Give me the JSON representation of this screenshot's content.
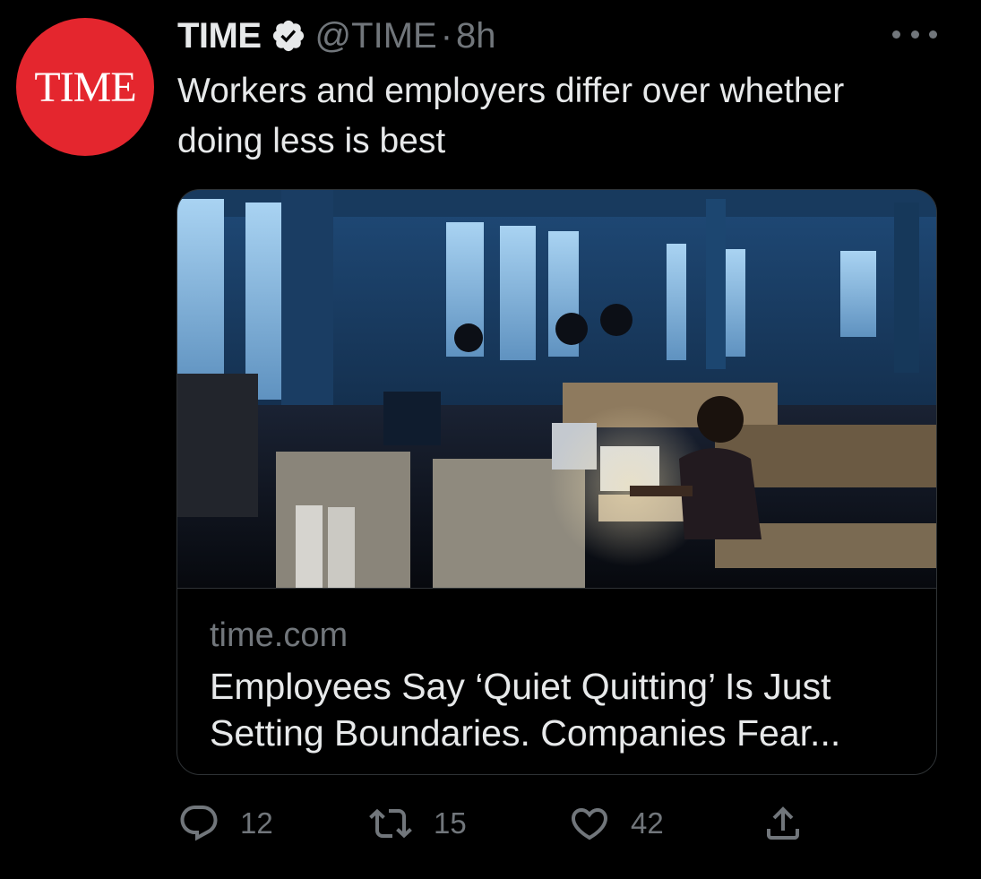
{
  "author": {
    "avatar_text": "TIME",
    "display_name": "TIME",
    "handle": "@TIME",
    "separator": "·",
    "time_ago": "8h",
    "verified_icon": "verified-badge-icon",
    "avatar_color": "#e4262e"
  },
  "tweet": {
    "text": "Workers and employers differ over whether doing less is best"
  },
  "card": {
    "image_icon": "office-photo",
    "domain": "time.com",
    "title": "Employees Say ‘Quiet Quitting’ Is Just Setting Boundaries. Companies Fear..."
  },
  "actions": {
    "reply": {
      "icon": "reply-icon",
      "count": "12"
    },
    "retweet": {
      "icon": "retweet-icon",
      "count": "15"
    },
    "like": {
      "icon": "heart-icon",
      "count": "42"
    },
    "share": {
      "icon": "share-icon"
    }
  },
  "colors": {
    "background": "#000000",
    "text_primary": "#e7e9ea",
    "text_secondary": "#71767b",
    "border": "#2f3336"
  }
}
